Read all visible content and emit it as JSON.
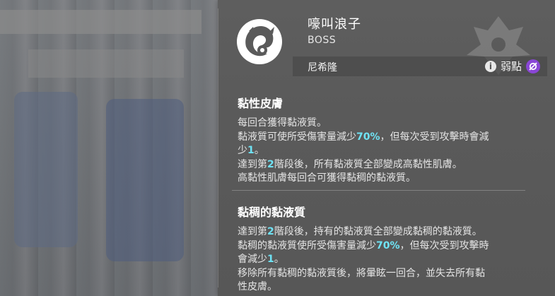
{
  "boss": {
    "name": "嚎叫浪子",
    "rank": "BOSS",
    "element": "尼希隆",
    "info_icon": "i",
    "weakness_label": "弱點"
  },
  "icons": {
    "emblem": "boss-emblem-icon",
    "info": "info-icon",
    "weakness": "weakness-element-icon",
    "art": "boss-art-watermark"
  },
  "colors": {
    "highlight": "#6fe3f5",
    "weakness": "#8a46d6"
  },
  "skills": [
    {
      "title": "黏性皮膚",
      "lines": [
        [
          "每回合獲得黏液質。"
        ],
        [
          "黏液質可使所受傷害量減少",
          "70%",
          "，但每次受到攻擊時會減"
        ],
        [
          "少",
          "1",
          "。"
        ],
        [
          "達到第",
          "2",
          "階段後，所有黏液質全部變成高黏性肌膚。"
        ],
        [
          "高黏性肌膚每回合可獲得黏稠的黏液質。"
        ]
      ]
    },
    {
      "title": "黏稠的黏液質",
      "lines": [
        [
          "達到第",
          "2",
          "階段後，持有的黏液質全部變成黏稠的黏液質。"
        ],
        [
          "黏稠的黏液質使所受傷害量減少",
          "70%",
          "，但每次受到攻擊時"
        ],
        [
          "會減少",
          "1",
          "。"
        ],
        [
          "移除所有黏稠的黏液質後，將暈眩一回合，並失去所有黏"
        ],
        [
          "性皮膚。"
        ]
      ]
    }
  ]
}
